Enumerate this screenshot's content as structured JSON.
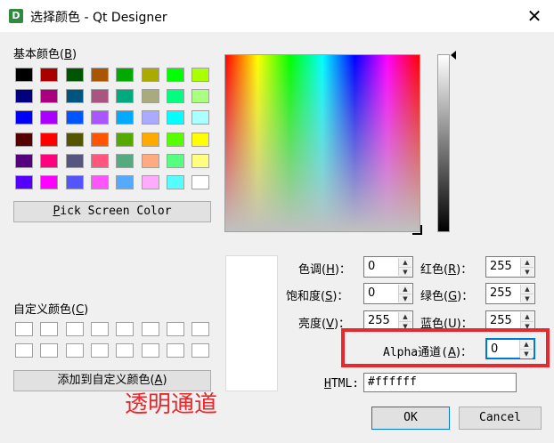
{
  "window": {
    "title": "选择颜色 - Qt Designer",
    "icon_letter": "D",
    "close_glyph": "✕"
  },
  "basic_colors": {
    "label_prefix": "基本颜色(",
    "label_key": "B",
    "label_suffix": ")",
    "colors": [
      "#000000",
      "#aa0000",
      "#005500",
      "#aa5500",
      "#00aa00",
      "#aaaa00",
      "#00ff00",
      "#aaff00",
      "#00007f",
      "#aa007f",
      "#00557f",
      "#aa557f",
      "#00aa7f",
      "#aaaa7f",
      "#00ff7f",
      "#aaff7f",
      "#0000ff",
      "#aa00ff",
      "#0055ff",
      "#aa55ff",
      "#00aaff",
      "#aaaaff",
      "#00ffff",
      "#aaffff",
      "#550000",
      "#ff0000",
      "#555500",
      "#ff5500",
      "#55aa00",
      "#ffaa00",
      "#55ff00",
      "#ffff00",
      "#55007f",
      "#ff007f",
      "#55557f",
      "#ff557f",
      "#55aa7f",
      "#ffaa7f",
      "#55ff7f",
      "#ffff7f",
      "#5500ff",
      "#ff00ff",
      "#5555ff",
      "#ff55ff",
      "#55aaff",
      "#ffaaff",
      "#55ffff",
      "#ffffff"
    ]
  },
  "pick_screen": {
    "label_key": "P",
    "label_rest": "ick Screen Color"
  },
  "custom_colors": {
    "label_prefix": "自定义颜色(",
    "label_key": "C",
    "label_suffix": ")",
    "colors": [
      "#ffffff",
      "#ffffff",
      "#ffffff",
      "#ffffff",
      "#ffffff",
      "#ffffff",
      "#ffffff",
      "#ffffff",
      "#ffffff",
      "#ffffff",
      "#ffffff",
      "#ffffff",
      "#ffffff",
      "#ffffff",
      "#ffffff",
      "#ffffff"
    ]
  },
  "add_custom": {
    "label_prefix": "添加到自定义颜色(",
    "label_key": "A",
    "label_suffix": ")"
  },
  "current_color": "#ffffff",
  "fields": {
    "hue": {
      "prefix": "色调(",
      "key": "H",
      "suffix": ")：",
      "value": "0"
    },
    "saturation": {
      "prefix": "饱和度(",
      "key": "S",
      "suffix": ")：",
      "value": "0"
    },
    "value": {
      "prefix": "亮度(",
      "key": "V",
      "suffix": ")：",
      "value": "255"
    },
    "red": {
      "prefix": "红色(",
      "key": "R",
      "suffix": ")：",
      "value": "255"
    },
    "green": {
      "prefix": "绿色(",
      "key": "G",
      "suffix": ")：",
      "value": "255"
    },
    "blue": {
      "prefix": "蓝色(",
      "key": "U",
      "suffix": ")：",
      "value": "255"
    },
    "alpha": {
      "prefix": "Alpha通道(",
      "key": "A",
      "suffix": ")：",
      "value": "0"
    }
  },
  "html": {
    "label_key": "H",
    "label_rest": "TML:",
    "value": "#ffffff"
  },
  "buttons": {
    "ok": "OK",
    "cancel": "Cancel"
  },
  "annotation": {
    "text": "透明通道",
    "color": "#e8282c",
    "box_color": "#e8282c"
  }
}
